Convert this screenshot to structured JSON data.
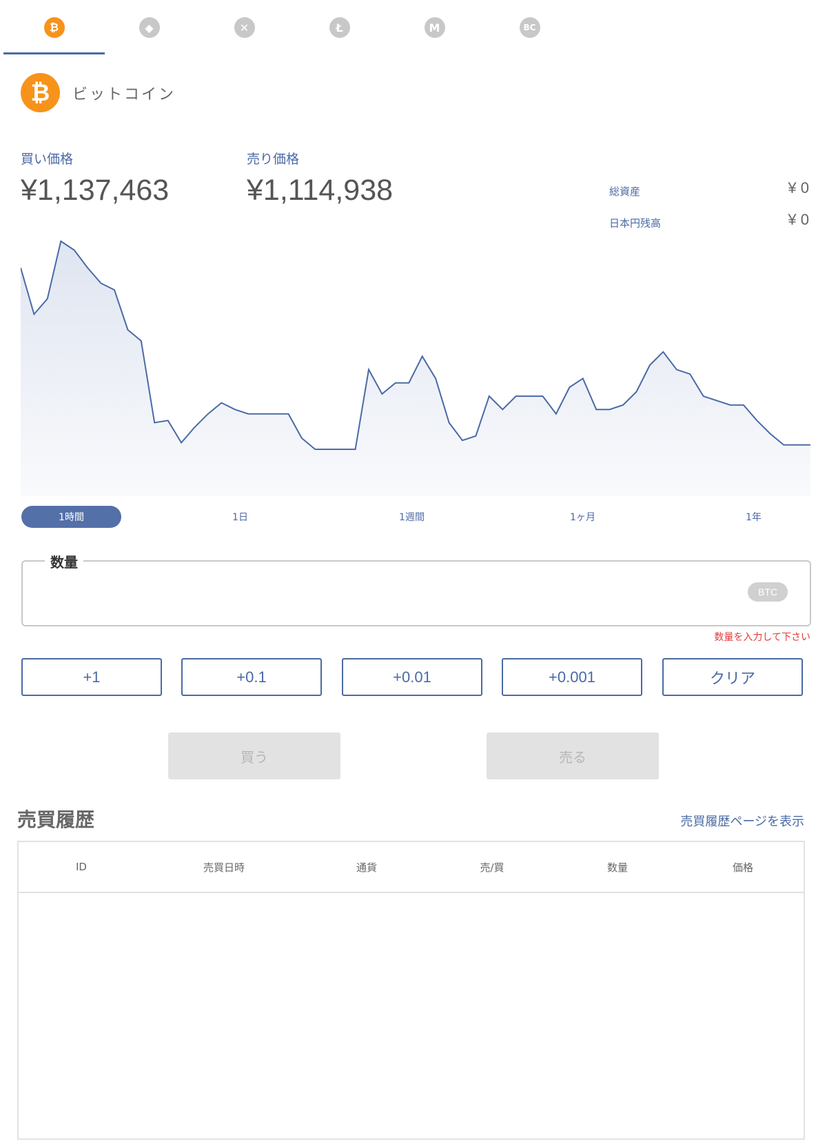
{
  "tabs": [
    {
      "icon": "bitcoin-icon",
      "glyph": "₿",
      "active": true
    },
    {
      "icon": "ethereum-icon",
      "glyph": "◆",
      "active": false
    },
    {
      "icon": "ripple-icon",
      "glyph": "✕",
      "active": false
    },
    {
      "icon": "litecoin-icon",
      "glyph": "Ł",
      "active": false
    },
    {
      "icon": "monacoin-icon",
      "glyph": "M",
      "active": false
    },
    {
      "icon": "bitcoin-cash-icon",
      "glyph": "BC",
      "active": false
    }
  ],
  "coin": {
    "name": "ビットコイン",
    "logo_glyph": "₿",
    "color": "#f7931a"
  },
  "prices": {
    "buy_label": "買い価格",
    "buy_value": "¥1,137,463",
    "sell_label": "売り価格",
    "sell_value": "¥1,114,938"
  },
  "balances": {
    "total_label": "総資産",
    "total_value": "¥ 0",
    "jpy_label": "日本円残高",
    "jpy_value": "¥ 0"
  },
  "chart_data": {
    "type": "area",
    "x": [
      0,
      1,
      2,
      3,
      4,
      5,
      6,
      7,
      8,
      9,
      10,
      11,
      12,
      13,
      14,
      15,
      16,
      17,
      18,
      19,
      20,
      21,
      22,
      23,
      24,
      25,
      26,
      27,
      28,
      29,
      30,
      31,
      32,
      33,
      34,
      35,
      36,
      37,
      38,
      39,
      40,
      41,
      42,
      43,
      44,
      45,
      46,
      47,
      48,
      49,
      50,
      51,
      52,
      53,
      54,
      55,
      56,
      57,
      58,
      59,
      60,
      61
    ],
    "values": [
      72,
      51,
      58,
      84,
      80,
      72,
      65,
      62,
      44,
      39,
      2,
      3,
      -7,
      0,
      6,
      11,
      8,
      6,
      6,
      6,
      6,
      -5,
      -10,
      -10,
      -10,
      -10,
      26,
      15,
      20,
      20,
      32,
      22,
      2,
      -6,
      -4,
      14,
      8,
      14,
      14,
      14,
      6,
      18,
      22,
      8,
      8,
      10,
      16,
      28,
      34,
      26,
      24,
      14,
      12,
      10,
      10,
      3,
      -3,
      -8,
      -8,
      -8
    ],
    "color": "#4a6aa5",
    "title": "",
    "xlabel": "",
    "ylabel": ""
  },
  "ranges": [
    {
      "label": "1時間",
      "active": true
    },
    {
      "label": "1日",
      "active": false
    },
    {
      "label": "1週間",
      "active": false
    },
    {
      "label": "1ヶ月",
      "active": false
    },
    {
      "label": "1年",
      "active": false
    }
  ],
  "quantity": {
    "label": "数量",
    "value": "",
    "unit": "BTC",
    "error": "数量を入力して下さい"
  },
  "increments": [
    "+1",
    "+0.1",
    "+0.01",
    "+0.001",
    "クリア"
  ],
  "actions": {
    "buy": "買う",
    "sell": "売る"
  },
  "history": {
    "title": "売買履歴",
    "link": "売買履歴ページを表示",
    "columns": [
      "ID",
      "売買日時",
      "通貨",
      "売/買",
      "数量",
      "価格"
    ],
    "rows": []
  }
}
